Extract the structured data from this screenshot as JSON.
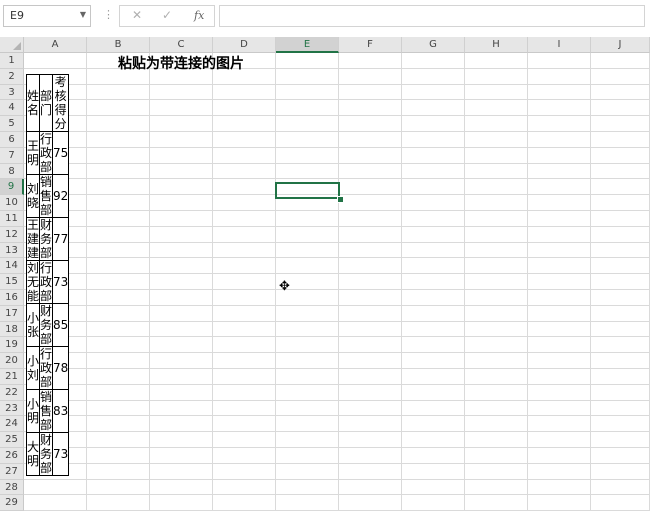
{
  "formula_bar": {
    "name_box": "E9",
    "cancel_icon": "✕",
    "enter_icon": "✓",
    "fx_label": "fx",
    "formula_value": ""
  },
  "columns": [
    "A",
    "B",
    "C",
    "D",
    "E",
    "F",
    "G",
    "H",
    "I",
    "J"
  ],
  "selected_column": "E",
  "rows": [
    "1",
    "2",
    "3",
    "4",
    "5",
    "6",
    "7",
    "8",
    "9",
    "10",
    "11",
    "12",
    "13",
    "14",
    "15",
    "16",
    "17",
    "18",
    "19",
    "20",
    "21",
    "22",
    "23",
    "24",
    "25",
    "26",
    "27",
    "28",
    "29"
  ],
  "selected_row": "9",
  "sheet": {
    "title": "粘贴为带连接的图片",
    "headers": [
      "姓名",
      "部门",
      "考核得分"
    ],
    "records": [
      [
        "王明",
        "行政部",
        "75"
      ],
      [
        "刘晓",
        "销售部",
        "92"
      ],
      [
        "王建建",
        "财务部",
        "77"
      ],
      [
        "刘无能",
        "行政部",
        "73"
      ],
      [
        "小张",
        "财务部",
        "85"
      ],
      [
        "小刘",
        "行政部",
        "78"
      ],
      [
        "小明",
        "销售部",
        "83"
      ],
      [
        "大明",
        "财务部",
        "73"
      ]
    ]
  },
  "colors": {
    "accent": "#217346",
    "grid": "#dadada",
    "header_bg": "#e6e6e6"
  },
  "icons": {
    "cursor": "cross-cursor-icon",
    "dropdown": "chevron-down-icon"
  }
}
